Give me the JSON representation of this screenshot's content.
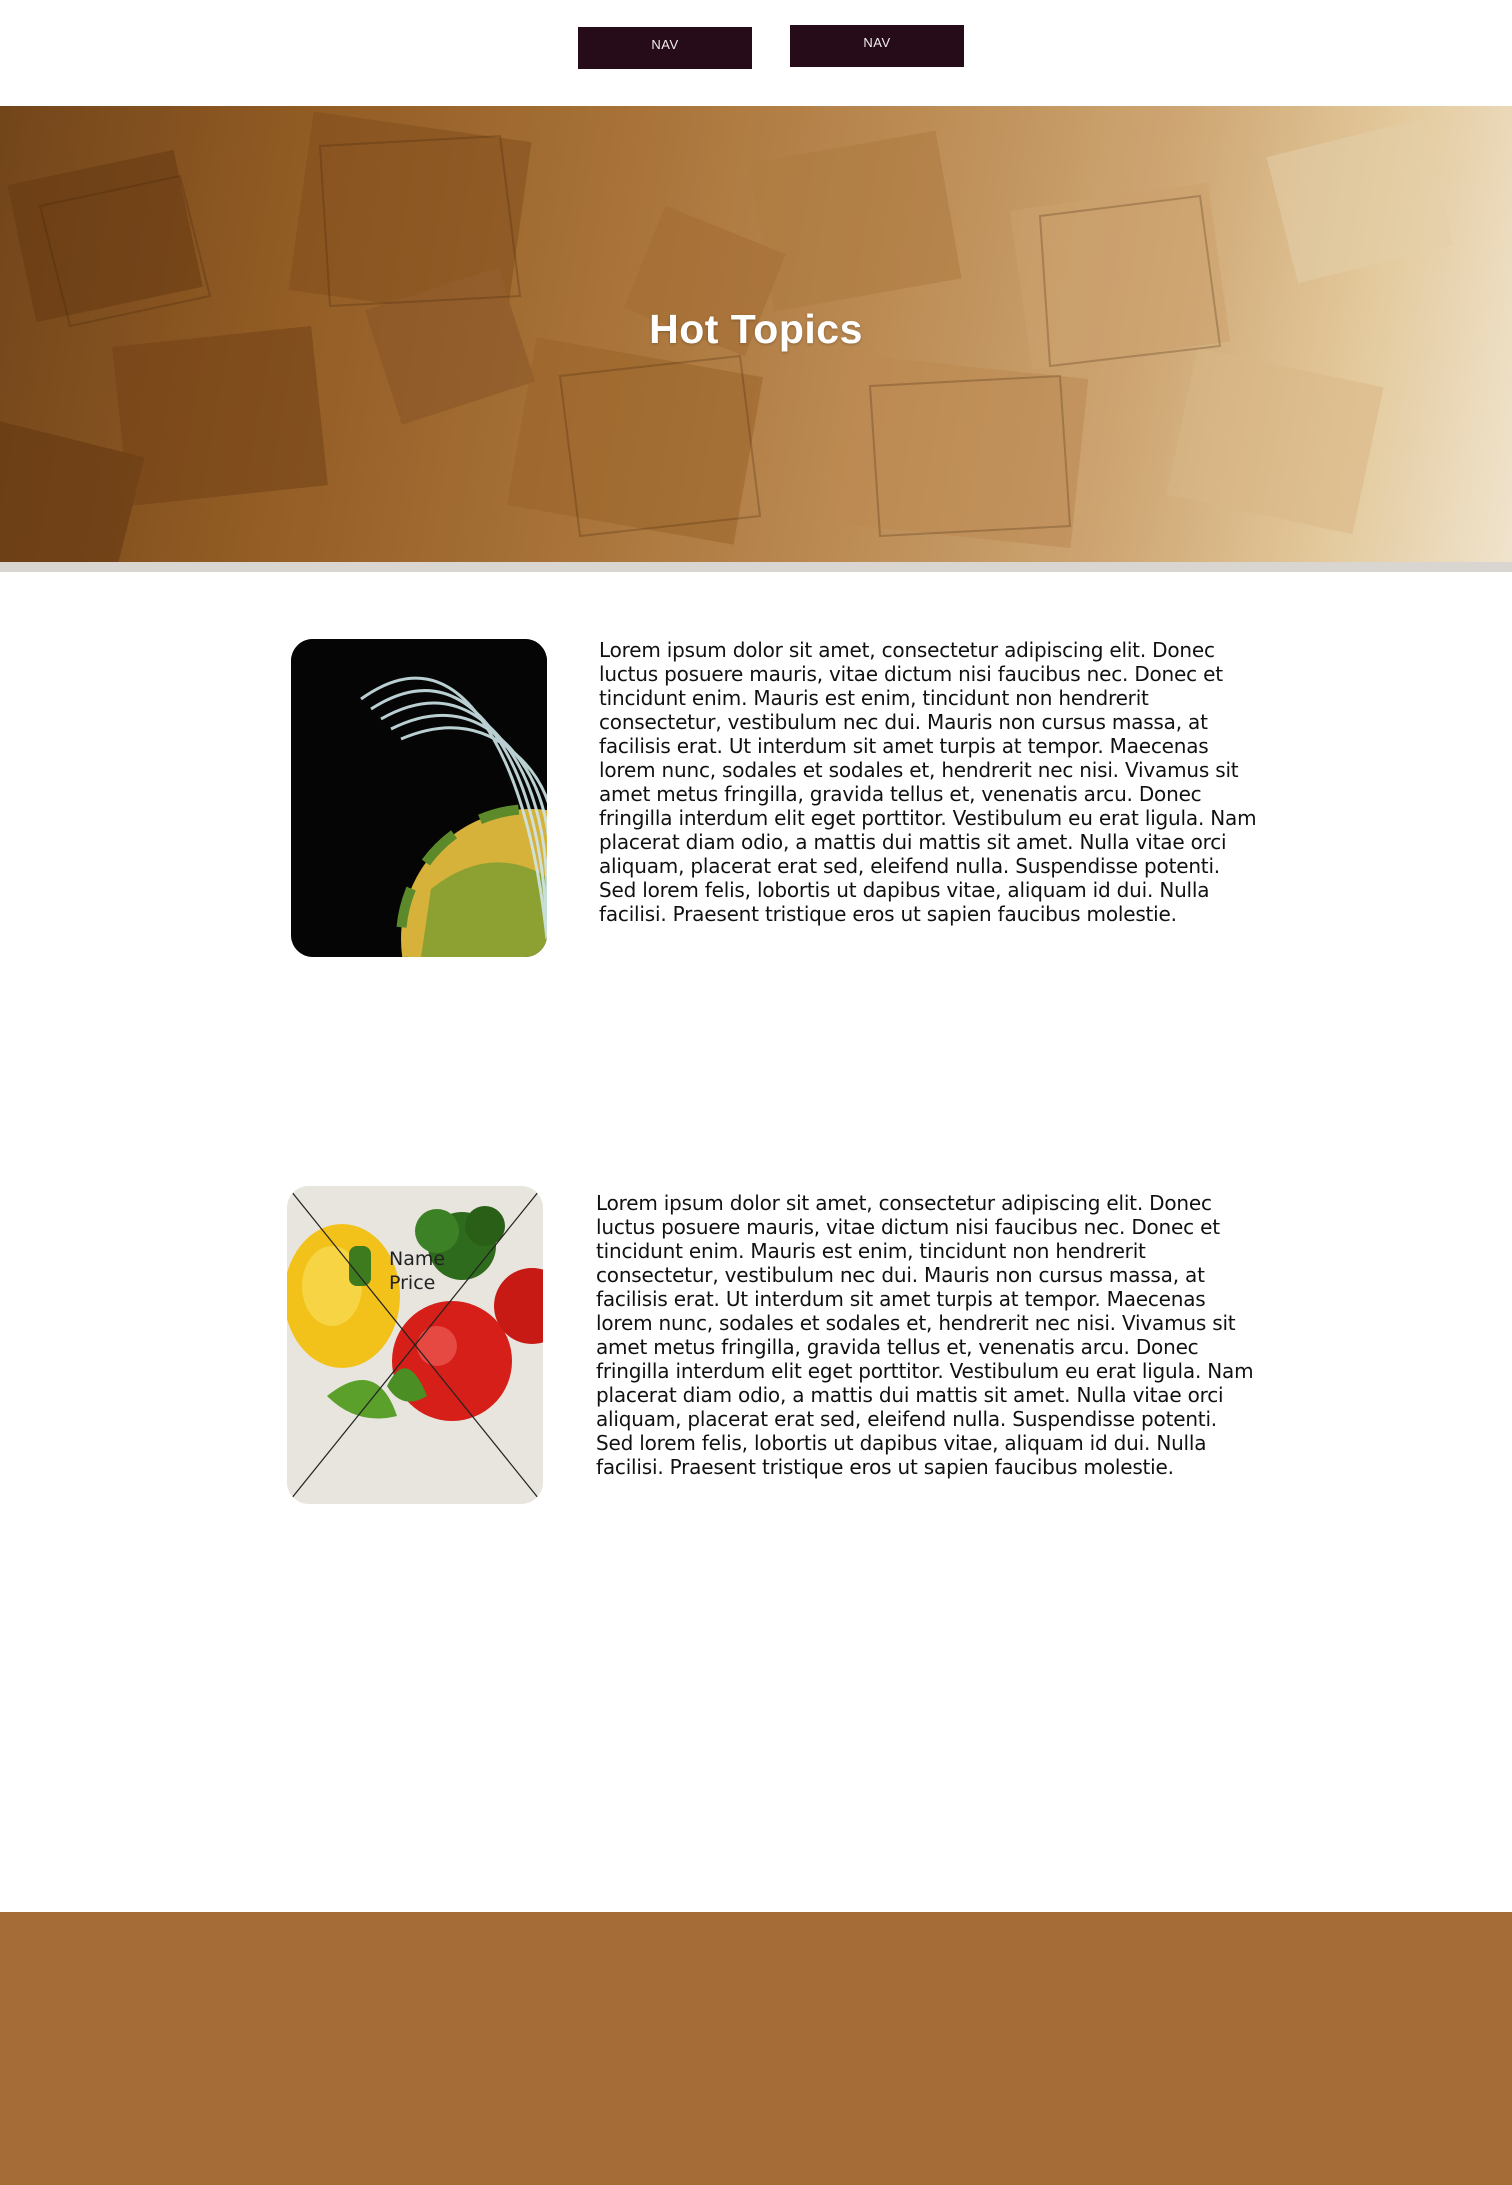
{
  "nav": {
    "items": [
      {
        "label": "NAV"
      },
      {
        "label": "NAV"
      }
    ]
  },
  "hero": {
    "title": "Hot Topics"
  },
  "articles": [
    {
      "image": "globe-orbit-image",
      "text": "Lorem ipsum dolor sit amet, consectetur adipiscing elit. Donec luctus posuere mauris, vitae dictum nisi faucibus nec. Donec et tincidunt enim.  Mauris est enim, tincidunt non hendrerit consectetur, vestibulum nec  dui. Mauris non cursus massa, at facilisis erat. Ut interdum sit amet  turpis at tempor. Maecenas lorem nunc, sodales et sodales et, hendrerit  nec nisi. Vivamus sit amet metus fringilla, gravida tellus et, venenatis  arcu. Donec fringilla interdum elit eget porttitor. Vestibulum eu erat  ligula. Nam placerat diam odio, a mattis dui mattis sit amet. Nulla  vitae orci aliquam, placerat erat sed, eleifend nulla. Suspendisse  potenti. Sed lorem felis, lobortis ut dapibus vitae, aliquam id dui.  Nulla facilisi. Praesent tristique eros ut sapien faucibus molestie."
    },
    {
      "image": "vegetables-image",
      "name_label": "Name",
      "price_label": "Price",
      "text": "Lorem ipsum dolor sit amet, consectetur adipiscing elit. Donec luctus posuere mauris, vitae dictum nisi faucibus nec. Donec et tincidunt enim.  Mauris est enim, tincidunt non hendrerit consectetur, vestibulum nec  dui. Mauris non cursus massa, at facilisis erat. Ut interdum sit amet  turpis at tempor. Maecenas lorem nunc, sodales et sodales et, hendrerit  nec nisi. Vivamus sit amet metus fringilla, gravida tellus et, venenatis  arcu. Donec fringilla interdum elit eget porttitor. Vestibulum eu erat  ligula. Nam placerat diam odio, a mattis dui mattis sit amet. Nulla  vitae orci aliquam, placerat erat sed, eleifend nulla. Suspendisse  potenti. Sed lorem felis, lobortis ut dapibus vitae, aliquam id dui.  Nulla facilisi. Praesent tristique eros ut sapien faucibus molestie."
    }
  ],
  "colors": {
    "nav_bg": "#260c18",
    "footer_bg": "#a66c38",
    "hero_overlay_text": "#ffffff"
  }
}
